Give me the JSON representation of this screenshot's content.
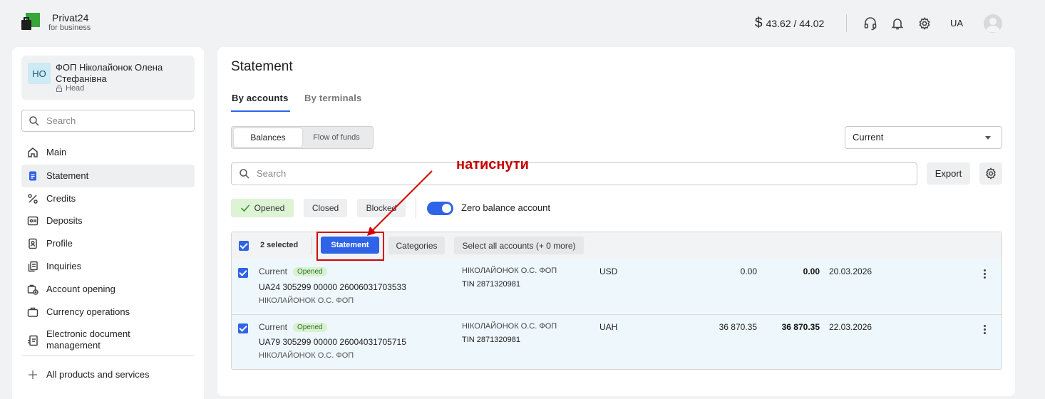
{
  "header": {
    "brand_name": "Privat24",
    "brand_sub": "for business",
    "rate": "43.62 / 44.02",
    "currency_symbol": "$",
    "lang": "UA"
  },
  "sidebar": {
    "company_initials": "НО",
    "company_name": "ФОП Ніколайонок Олена Стефанівна",
    "company_role": "Head",
    "search_placeholder": "Search",
    "items": [
      {
        "label": "Main"
      },
      {
        "label": "Statement"
      },
      {
        "label": "Credits"
      },
      {
        "label": "Deposits"
      },
      {
        "label": "Profile"
      },
      {
        "label": "Inquiries"
      },
      {
        "label": "Account opening"
      },
      {
        "label": "Currency operations"
      },
      {
        "label": "Electronic document management"
      },
      {
        "label": "All products and services"
      }
    ]
  },
  "main": {
    "title": "Statement",
    "tabs": [
      {
        "label": "By accounts"
      },
      {
        "label": "By terminals"
      }
    ],
    "segment": {
      "on": "Balances",
      "off": "Flow of funds"
    },
    "select_value": "Current",
    "search_placeholder": "Search",
    "export_label": "Export",
    "filters": {
      "opened": "Opened",
      "closed": "Closed",
      "blocked": "Blocked"
    },
    "toggle_label": "Zero balance account",
    "table": {
      "selected_count": "2 selected",
      "statement_btn": "Statement",
      "categories_btn": "Categories",
      "select_all_btn": "Select all accounts (+ 0 more)",
      "rows": [
        {
          "type": "Current",
          "status": "Opened",
          "iban": "UA24 305299 00000 26006031703533",
          "owner": "НІКОЛАЙОНОК О.С. ФОП",
          "holder": "НІКОЛАЙОНОК О.С. ФОП",
          "tin": "TIN 2871320981",
          "currency": "USD",
          "balance": "0.00",
          "balance_bold": "0.00",
          "date": "20.03.2026"
        },
        {
          "type": "Current",
          "status": "Opened",
          "iban": "UA79 305299 00000 26004031705715",
          "owner": "НІКОЛАЙОНОК О.С. ФОП",
          "holder": "НІКОЛАЙОНОК О.С. ФОП",
          "tin": "TIN 2871320981",
          "currency": "UAH",
          "balance": "36 870.35",
          "balance_bold": "36 870.35",
          "date": "22.03.2026"
        }
      ]
    }
  },
  "annotation": "натиснути",
  "colors": {
    "accent": "#2f63e8",
    "annotation": "#d40000",
    "brand": "#1f9e3c"
  }
}
